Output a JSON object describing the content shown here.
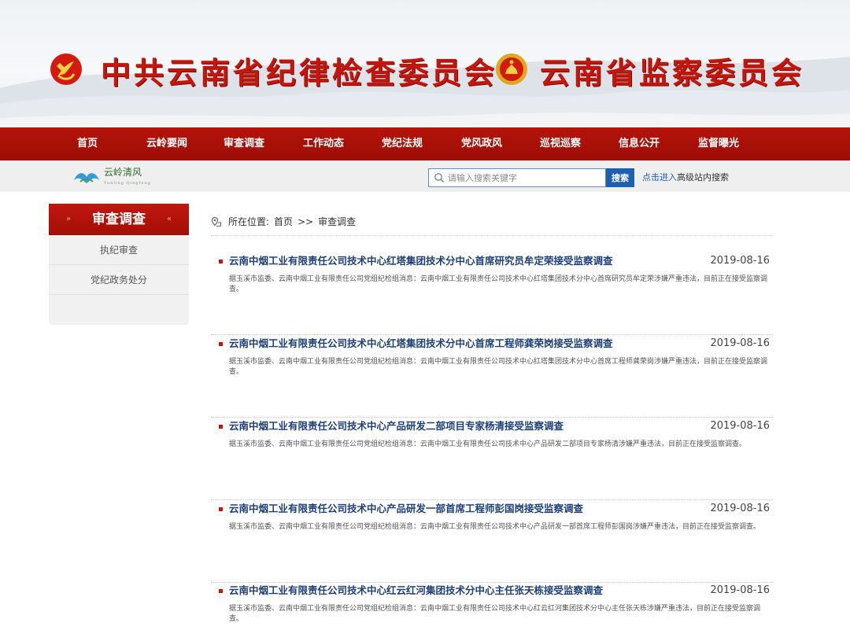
{
  "banner": {
    "left_title": "中共云南省纪律检查委员会",
    "right_title": "云南省监察委员会"
  },
  "nav": {
    "items": [
      "首页",
      "云岭要闻",
      "审查调查",
      "工作动态",
      "党纪法规",
      "党风政风",
      "巡视巡察",
      "信息公开",
      "监督曝光"
    ]
  },
  "subbar": {
    "logo_text": "云岭清风",
    "logo_subtext": "Yunling Qingfeng",
    "search_placeholder": "请输入搜索关键字",
    "search_button": "搜索",
    "advanced_link": "点击进入",
    "advanced_rest": "高级站内搜索"
  },
  "sidebar": {
    "header": "审查调查",
    "items": [
      "执纪审查",
      "党纪政务处分"
    ]
  },
  "breadcrumb": {
    "prefix": "所在位置:",
    "home": "首页",
    "separator": ">>",
    "current": "审查调查"
  },
  "articles": [
    {
      "title": "云南中烟工业有限责任公司技术中心红塔集团技术分中心首席研究员牟定荣接受监察调查",
      "date": "2019-08-16",
      "summary": "据玉溪市监委、云南中烟工业有限责任公司党组纪检组消息：云南中烟工业有限责任公司技术中心红塔集团技术分中心首席研究员牟定荣涉嫌严重违法，目前正在接受监察调查。"
    },
    {
      "title": "云南中烟工业有限责任公司技术中心红塔集团技术分中心首席工程师龚荣岗接受监察调查",
      "date": "2019-08-16",
      "summary": "据玉溪市监委、云南中烟工业有限责任公司党组纪检组消息：云南中烟工业有限责任公司技术中心红塔集团技术分中心首席工程师龚荣岗涉嫌严重违法，目前正在接受监察调查。"
    },
    {
      "title": "云南中烟工业有限责任公司技术中心产品研发二部项目专家杨清接受监察调查",
      "date": "2019-08-16",
      "summary": "据玉溪市监委、云南中烟工业有限责任公司党组纪检组消息：云南中烟工业有限责任公司技术中心产品研发二部项目专家杨清涉嫌严重违法，目前正在接受监察调查。"
    },
    {
      "title": "云南中烟工业有限责任公司技术中心产品研发一部首席工程师彭国岗接受监察调查",
      "date": "2019-08-16",
      "summary": "据玉溪市监委、云南中烟工业有限责任公司党组纪检组消息：云南中烟工业有限责任公司技术中心产品研发一部首席工程师彭国岗涉嫌严重违法，目前正在接受监察调查。"
    },
    {
      "title": "云南中烟工业有限责任公司技术中心红云红河集团技术分中心主任张天栋接受监察调查",
      "date": "2019-08-16",
      "summary": "据玉溪市监委、云南中烟工业有限责任公司党组纪检组消息：云南中烟工业有限责任公司技术中心红云红河集团技术分中心主任张天栋涉嫌严重违法，目前正在接受监察调查。"
    }
  ],
  "colors": {
    "brand_red": "#c5160c",
    "nav_red": "#a8110a",
    "link_blue": "#1d3f7a",
    "search_blue": "#1f5fb2"
  }
}
